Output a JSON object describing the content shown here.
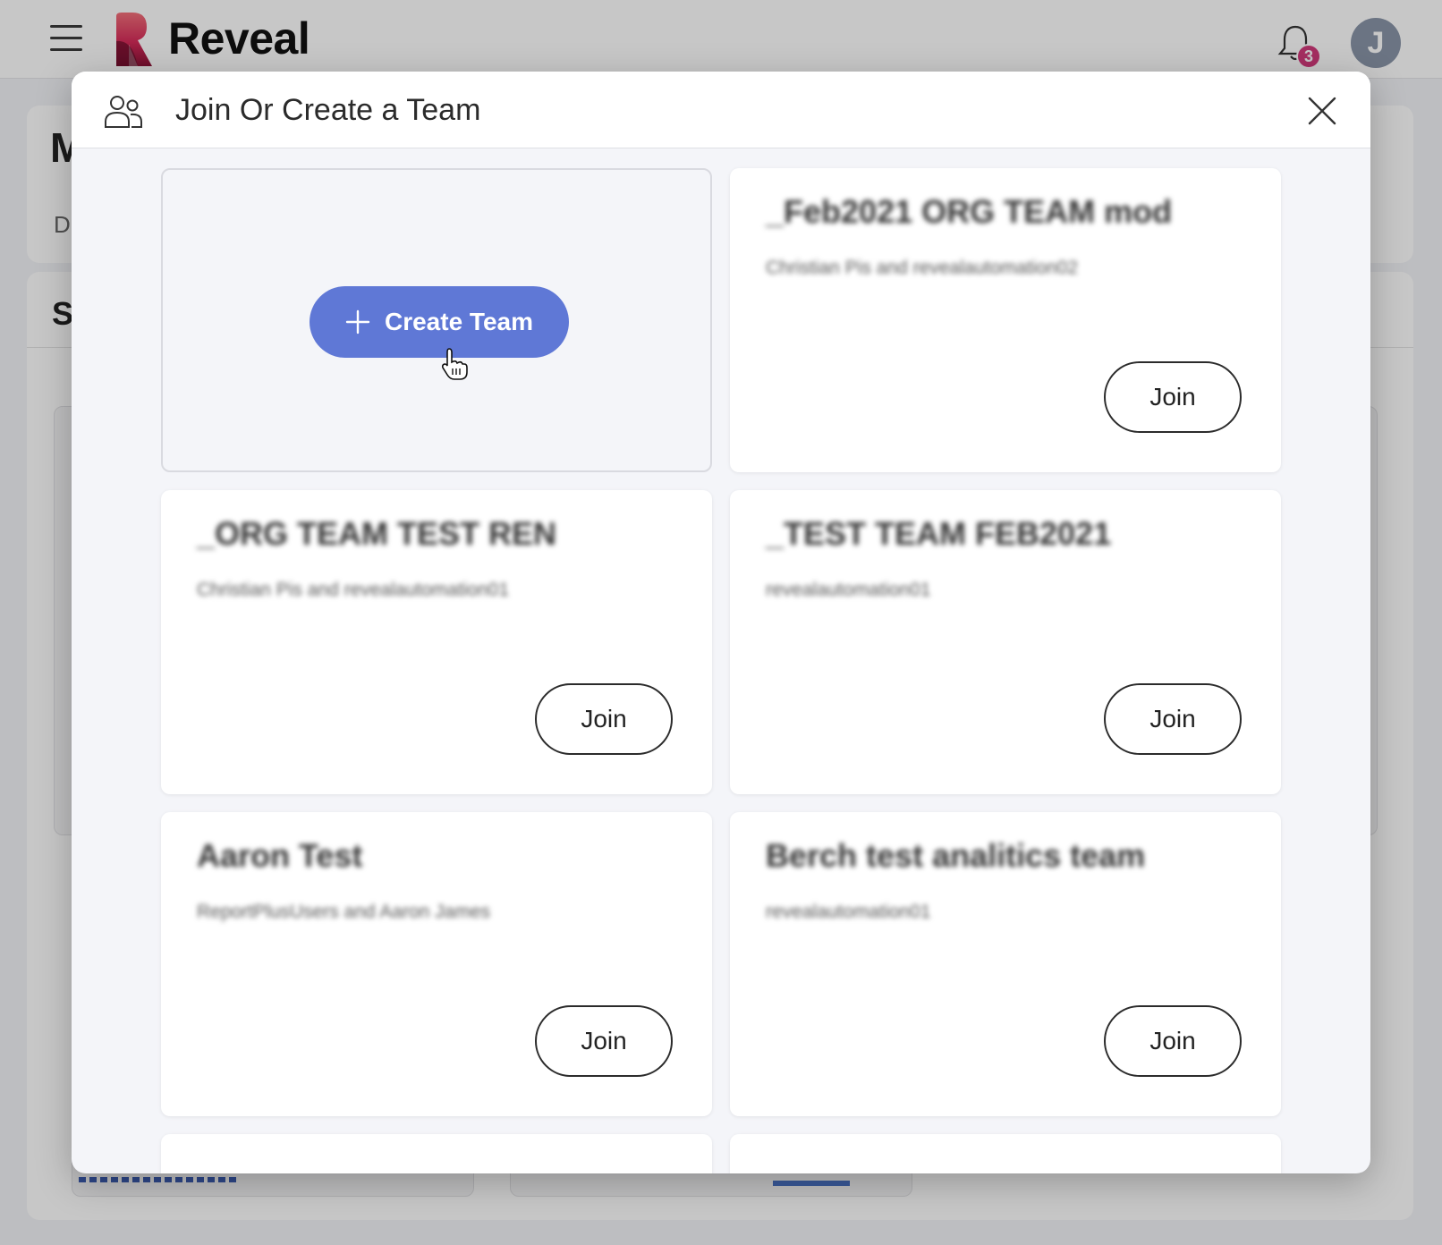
{
  "app": {
    "brand": "Reveal",
    "notification_count": "3",
    "avatar_initial": "J",
    "bg_title_letter": "M",
    "bg_subtitle_letter": "D",
    "bg_section_letter": "S"
  },
  "modal": {
    "title": "Join Or Create a Team",
    "create_label": "Create Team",
    "teams": [
      {
        "name": "_Feb2021 ORG TEAM mod",
        "members": "Christian Pis and revealautomation02",
        "join_label": "Join"
      },
      {
        "name": "_ORG TEAM TEST REN",
        "members": "Christian Pis and revealautomation01",
        "join_label": "Join"
      },
      {
        "name": "_TEST TEAM FEB2021",
        "members": "revealautomation01",
        "join_label": "Join"
      },
      {
        "name": "Aaron Test",
        "members": "ReportPlusUsers and Aaron James",
        "join_label": "Join"
      },
      {
        "name": "Berch test analitics team",
        "members": "revealautomation01",
        "join_label": "Join"
      }
    ]
  },
  "colors": {
    "accent": "#5f78d6",
    "badge": "#d23a7c",
    "avatar": "#8a95a8"
  }
}
